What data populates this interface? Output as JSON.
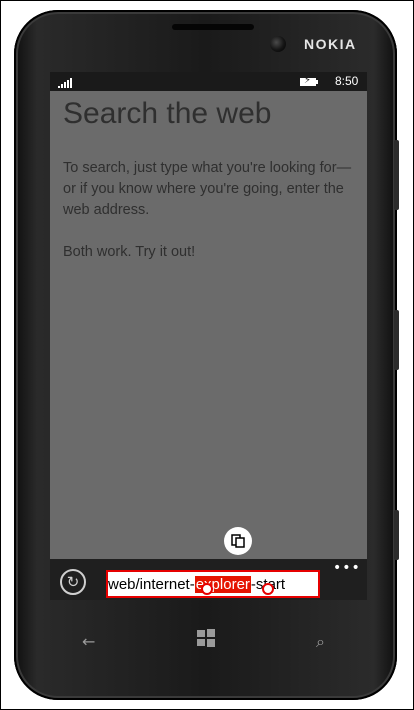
{
  "device": {
    "brand": "NOKIA"
  },
  "status_bar": {
    "time": "8:50",
    "signal_icon": "signal-bars-icon",
    "battery_icon": "battery-charging-icon"
  },
  "page": {
    "title": "Search the web",
    "paragraph1": "To search, just type what you're looking for—or if you know where you're going, enter the web address.",
    "paragraph2": "Both work. Try it out!"
  },
  "paste_button": {
    "icon": "paste-icon"
  },
  "app_bar": {
    "refresh_icon": "refresh-icon",
    "address": {
      "before": "web/internet-",
      "selected": "explorer",
      "after": "-start"
    },
    "more_label": "•••"
  },
  "nav_buttons": {
    "back": "←",
    "search": "⌕"
  },
  "colors": {
    "selection": "#e51400",
    "screen_background": "#6b6b6b",
    "app_bar": "#1f1f1f"
  }
}
